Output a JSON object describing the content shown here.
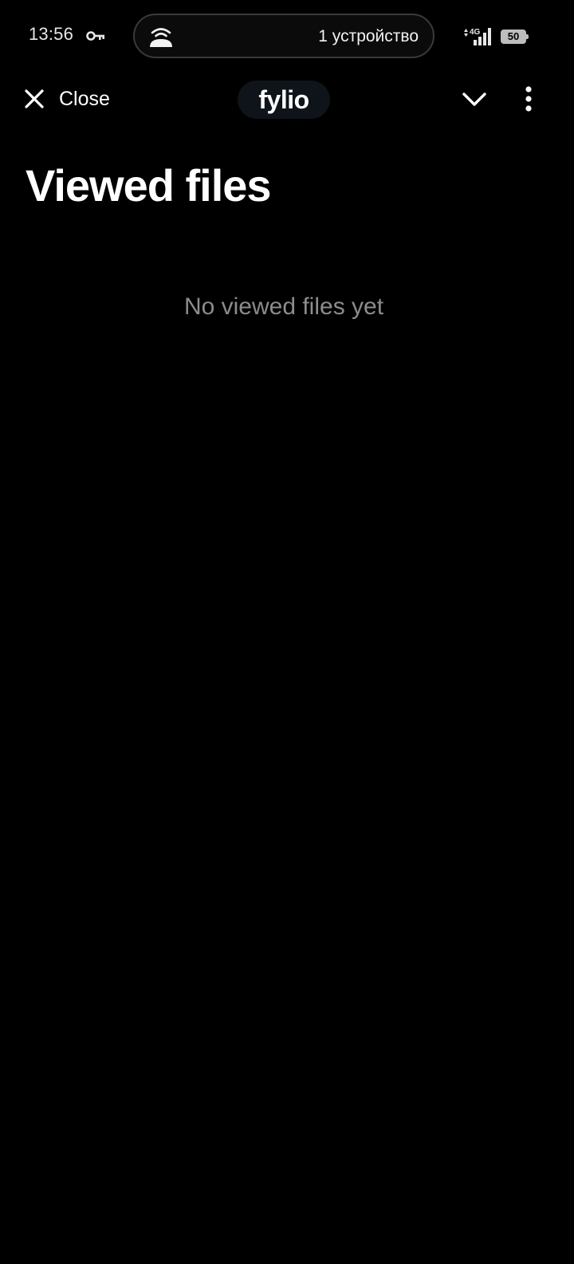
{
  "status_bar": {
    "time": "13:56",
    "device_indicator": "1 устройство",
    "network_type": "4G",
    "battery_level": "50",
    "icons": [
      "vpn-key-icon",
      "device-share-icon",
      "signal-icon",
      "battery-icon"
    ]
  },
  "header": {
    "close_label": "Close",
    "brand": "fylio",
    "icons": [
      "close-icon",
      "chevron-down-icon",
      "more-vertical-icon"
    ]
  },
  "main": {
    "title": "Viewed files",
    "empty_message": "No viewed files yet"
  },
  "colors": {
    "background": "#000000",
    "text_primary": "#ffffff",
    "text_muted": "#8c8c8c",
    "brand_pill": "#0e141a"
  }
}
